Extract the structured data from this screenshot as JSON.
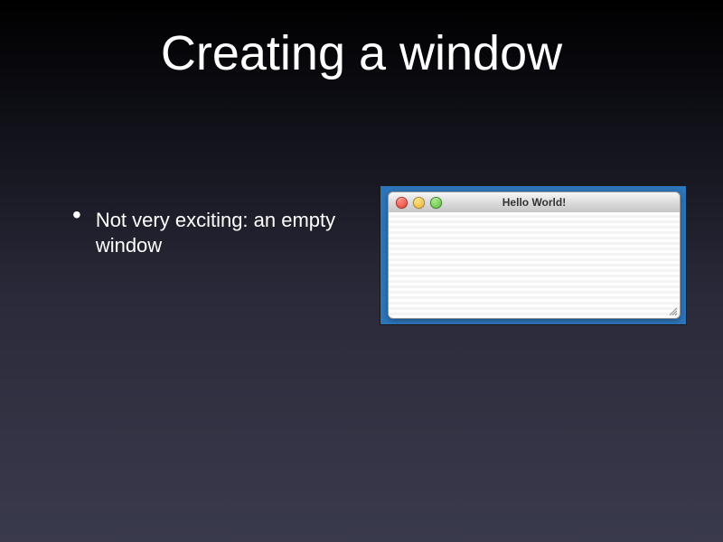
{
  "slide": {
    "title": "Creating a window",
    "bullets": [
      "Not very exciting: an empty window"
    ]
  },
  "embedded_window": {
    "title": "Hello World!",
    "traffic_lights": [
      "close",
      "minimize",
      "zoom"
    ]
  }
}
